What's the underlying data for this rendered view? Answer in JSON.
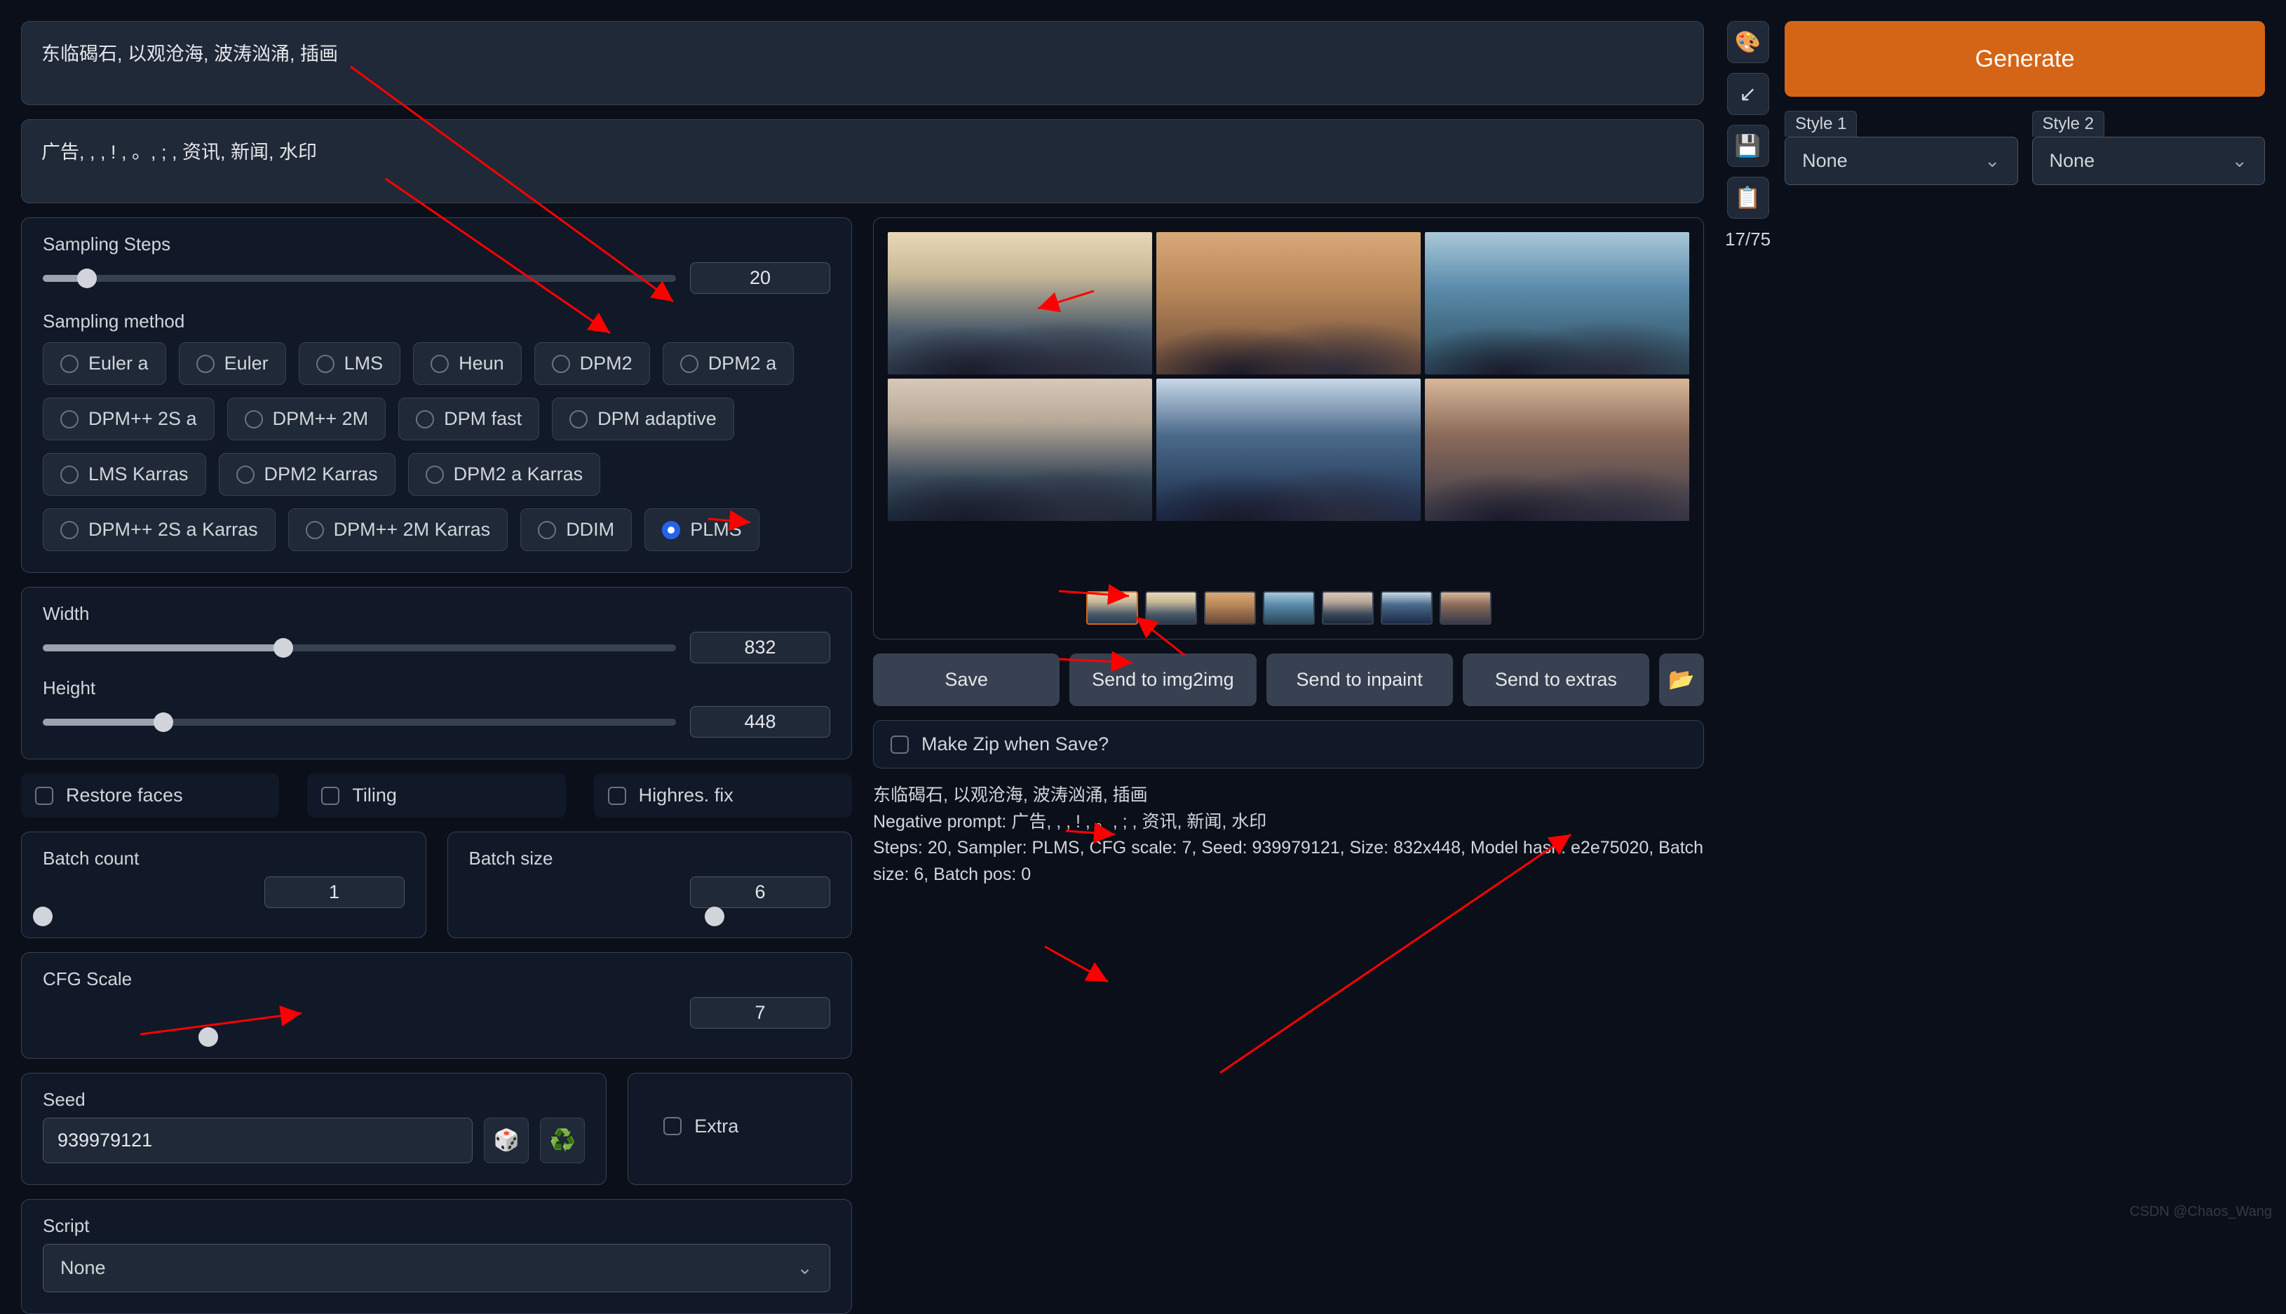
{
  "prompt": "东临碣石, 以观沧海, 波涛汹涌, 插画",
  "negative_prompt": "广告, , , ! , 。, ; , 资讯, 新闻, 水印",
  "token_counter": "17/75",
  "generate_label": "Generate",
  "styles": {
    "style1_label": "Style 1",
    "style1_value": "None",
    "style2_label": "Style 2",
    "style2_value": "None"
  },
  "tool_icons": [
    "🎨",
    "↙",
    "💾",
    "📋"
  ],
  "sampling": {
    "steps_label": "Sampling Steps",
    "steps_value": "20",
    "steps_pct": 7,
    "method_label": "Sampling method",
    "methods": [
      "Euler a",
      "Euler",
      "LMS",
      "Heun",
      "DPM2",
      "DPM2 a",
      "DPM++ 2S a",
      "DPM++ 2M",
      "DPM fast",
      "DPM adaptive",
      "LMS Karras",
      "DPM2 Karras",
      "DPM2 a Karras",
      "DPM++ 2S a Karras",
      "DPM++ 2M Karras",
      "DDIM",
      "PLMS"
    ],
    "selected_method": "PLMS"
  },
  "dims": {
    "width_label": "Width",
    "width_value": "832",
    "width_pct": 38,
    "height_label": "Height",
    "height_value": "448",
    "height_pct": 19
  },
  "checks": {
    "restore_faces": "Restore faces",
    "tiling": "Tiling",
    "highres_fix": "Highres. fix"
  },
  "batch": {
    "count_label": "Batch count",
    "count_value": "1",
    "count_pct": 0,
    "size_label": "Batch size",
    "size_value": "6",
    "size_pct": 68
  },
  "cfg": {
    "label": "CFG Scale",
    "value": "7",
    "pct": 21
  },
  "seed": {
    "label": "Seed",
    "value": "939979121",
    "dice_icon": "🎲",
    "recycle_icon": "♻️",
    "extra_label": "Extra"
  },
  "script": {
    "label": "Script",
    "value": "None"
  },
  "output": {
    "save": "Save",
    "send_img2img": "Send to img2img",
    "send_inpaint": "Send to inpaint",
    "send_extras": "Send to extras",
    "folder_icon": "📂",
    "zip_label": "Make Zip when Save?",
    "info_line1": "东临碣石, 以观沧海, 波涛汹涌, 插画",
    "info_line2": "Negative prompt: 广告, , , ! , 。, ; , 资讯, 新闻, 水印",
    "info_line3": "Steps: 20, Sampler: PLMS, CFG scale: 7, Seed: 939979121, Size: 832x448, Model hash: e2e75020, Batch size: 6, Batch pos: 0"
  },
  "watermark": "CSDN @Chaos_Wang"
}
